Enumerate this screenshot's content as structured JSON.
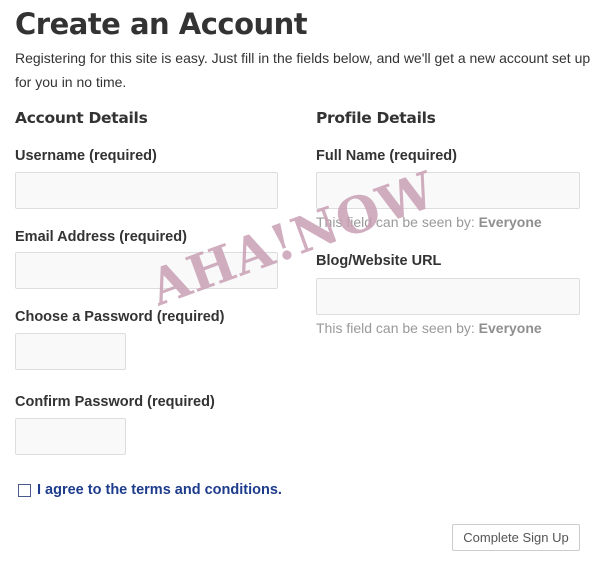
{
  "page": {
    "title": "Create an Account",
    "intro": "Registering for this site is easy. Just fill in the fields below, and we'll get a new account set up for you in no time."
  },
  "account_details": {
    "heading": "Account Details",
    "username": {
      "label": "Username (required)",
      "value": ""
    },
    "email": {
      "label": "Email Address (required)",
      "value": ""
    },
    "password": {
      "label": "Choose a Password (required)",
      "value": ""
    },
    "confirm_password": {
      "label": "Confirm Password (required)",
      "value": ""
    }
  },
  "profile_details": {
    "heading": "Profile Details",
    "full_name": {
      "label": "Full Name (required)",
      "value": "",
      "visibility_prefix": "This field can be seen by:",
      "visibility_level": "Everyone"
    },
    "website": {
      "label": "Blog/Website URL",
      "value": "",
      "visibility_prefix": "This field can be seen by:",
      "visibility_level": "Everyone"
    }
  },
  "terms": {
    "label": "I agree to the terms and conditions.",
    "checked": false
  },
  "submit": {
    "label": "Complete Sign Up"
  },
  "watermark": {
    "text": "AHA!NOW",
    "color": "#c8a0b4"
  }
}
